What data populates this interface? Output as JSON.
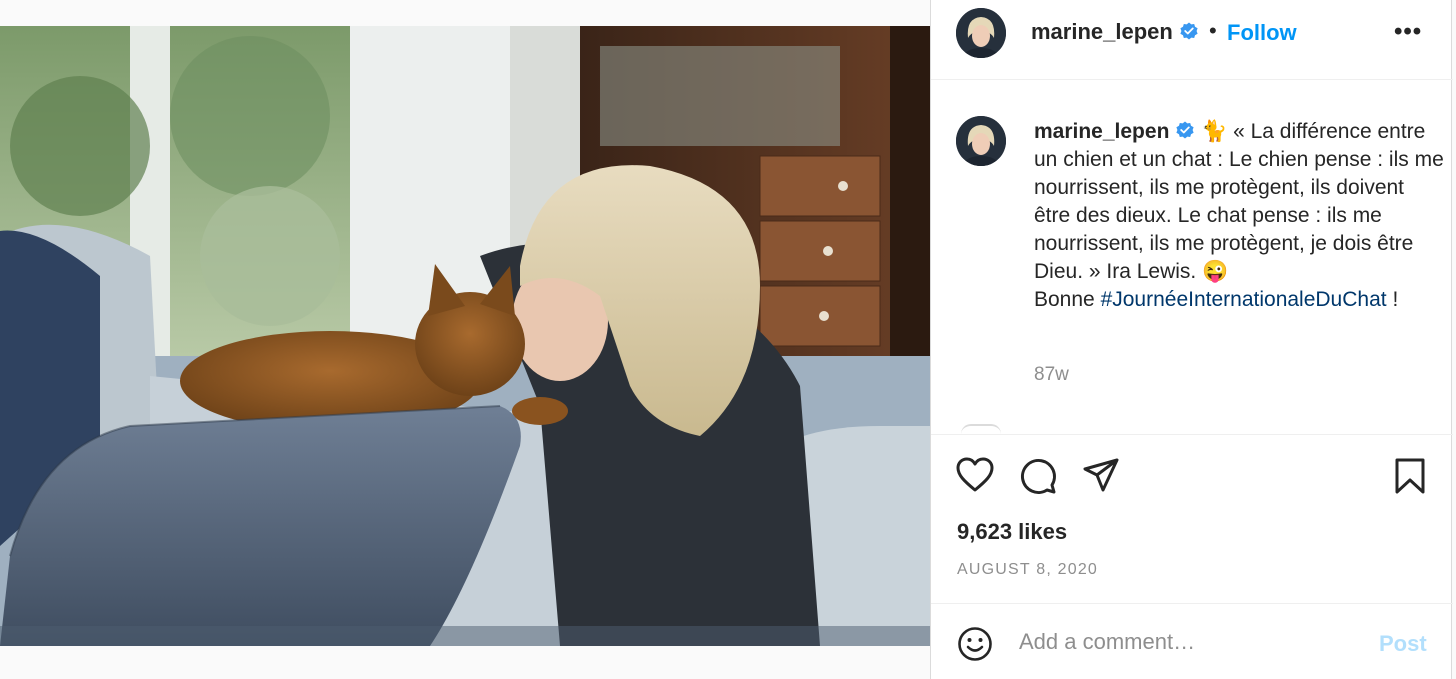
{
  "header": {
    "username": "marine_lepen",
    "separator": "•",
    "follow_label": "Follow",
    "more_label": "•••",
    "verified_icon": "verified-badge-icon"
  },
  "caption": {
    "username": "marine_lepen",
    "emoji_cat": "🐈",
    "text_main": " « La différence entre un chien et un chat : Le chien pense : ils me nourrissent, ils me protègent, ils doivent être des dieux. Le chat pense : ils me nourrissent, ils me protègent, je dois être Dieu. » Ira Lewis. ",
    "emoji_wink": "😜",
    "text_bonne": "Bonne ",
    "hashtag": "#JournéeInternationaleDuChat",
    "text_end": " !",
    "age": "87w"
  },
  "actions": {
    "like_icon": "heart-icon",
    "comment_icon": "comment-icon",
    "share_icon": "share-icon",
    "save_icon": "bookmark-icon"
  },
  "stats": {
    "likes": "9,623 likes",
    "date": "AUGUST 8, 2020"
  },
  "comment_bar": {
    "emoji_icon": "smiley-icon",
    "placeholder": "Add a comment…",
    "post_label": "Post"
  },
  "colors": {
    "accent": "#0095f6",
    "hashtag": "#00376b",
    "post_disabled": "#b2dffc",
    "muted": "#8e8e8e"
  }
}
